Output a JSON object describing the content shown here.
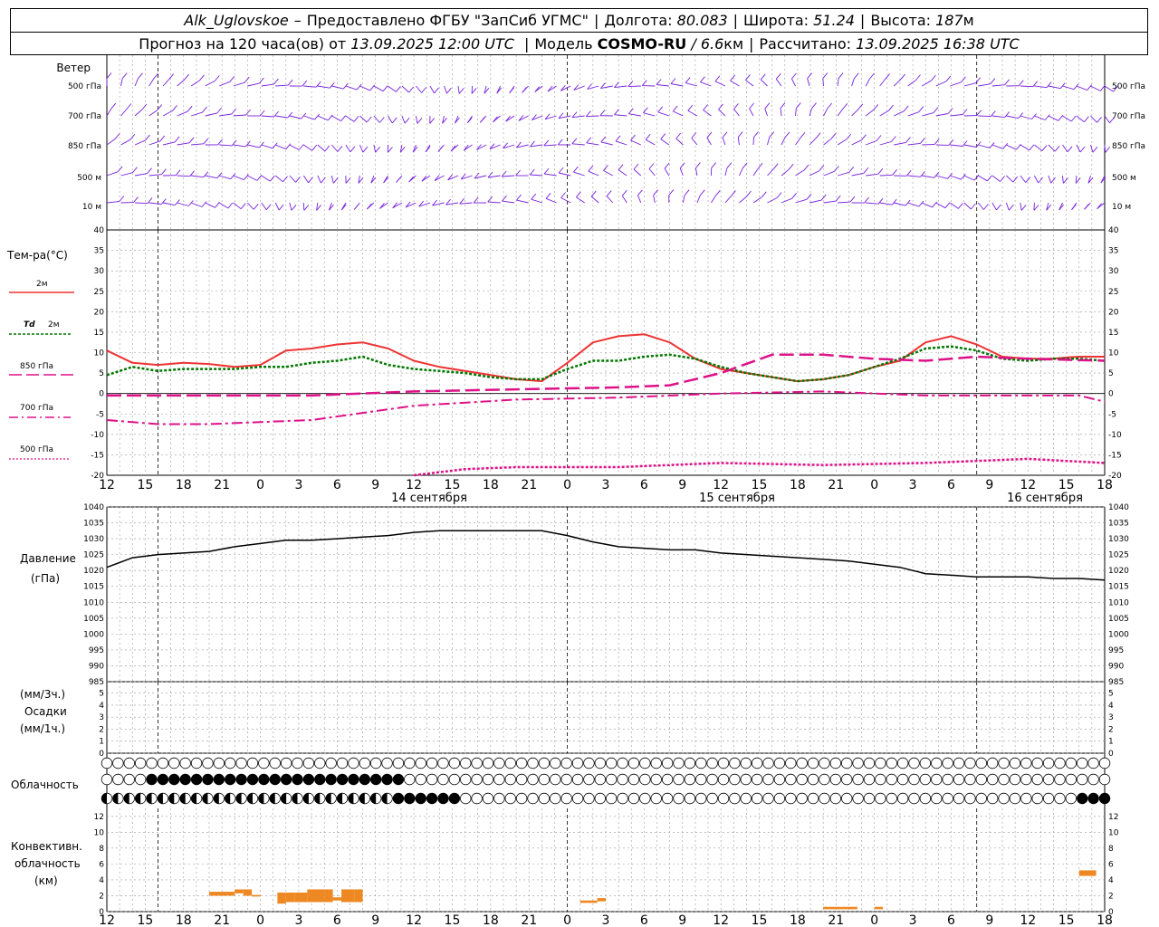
{
  "header": {
    "station": "Alk_Uglovskoe",
    "dash": "–",
    "provider": "Предоставлено ФГБУ \"ЗапСиб УГМС\"",
    "lon_label": "Долгота:",
    "lon_value": "80.083",
    "lat_label": "Широта:",
    "lat_value": "51.24",
    "alt_label": "Высота:",
    "alt_value": "187",
    "alt_unit": "м",
    "forecast_label": "Прогноз на 120 часа(ов) от",
    "forecast_time": "13.09.2025 12:00 UTC",
    "model_label": "Модель",
    "model_name": "COSMO-RU",
    "model_res": "/ 6.6",
    "model_res_unit": "км",
    "calc_label": "Рассчитано:",
    "calc_time": "13.09.2025 16:38 UTC"
  },
  "colors": {
    "t2m": "#ee3333",
    "td2m": "#007700",
    "t850": "#dd1188",
    "wind": "#7722dd",
    "cloud_conv": "#ee8822"
  },
  "labels": {
    "wind": "Ветер",
    "wind_levels": [
      "500 гПа",
      "700 гПа",
      "850 гПа",
      "500 м",
      "10  м"
    ],
    "temp_title": "Тем-ра(°С)",
    "temp_2m": "2м",
    "td": "Td",
    "td_2m": "2м",
    "t850": "850 гПа",
    "t700": "700 гПа",
    "t500": "500 гПа",
    "pressure": "Давление",
    "pressure_unit": "(гПа)",
    "precip_unit3": "(мм/3ч.)",
    "precip": "Осадки",
    "precip_unit1": "(мм/1ч.)",
    "clouds": "Облачность",
    "conv1": "Конвективн.",
    "conv2": "облачность",
    "conv3": "(км)"
  },
  "time_axis": {
    "hour_labels": [
      "12",
      "15",
      "18",
      "21",
      "0",
      "3",
      "6",
      "9",
      "12",
      "15",
      "18",
      "21",
      "0",
      "3",
      "6",
      "9",
      "12",
      "15",
      "18",
      "21",
      "0",
      "3",
      "6",
      "9",
      "12",
      "15",
      "18"
    ],
    "dates": [
      "14 сентября",
      "15 сентября",
      "16 сентября"
    ]
  },
  "chart_data": [
    {
      "type": "line",
      "title": "Тем-ра(°С)",
      "ylim": [
        -20,
        40
      ],
      "ticks": [
        "40",
        "35",
        "30",
        "25",
        "20",
        "15",
        "10",
        "5",
        "0",
        "-5",
        "-10",
        "-15",
        "-20"
      ],
      "x_hours": "hours since 13.09.2025 12:00 UTC",
      "series": [
        {
          "name": "2м",
          "x": [
            0,
            6,
            12,
            18,
            24,
            30,
            36,
            42,
            48,
            54,
            60,
            66,
            72,
            78,
            84,
            90,
            96,
            102,
            108,
            114,
            120,
            126,
            132,
            138,
            144,
            150,
            156,
            162,
            168,
            174,
            180,
            186,
            192,
            198,
            204,
            210,
            216,
            222,
            225,
            228,
            234
          ],
          "values": [
            10.5,
            7.5,
            7.0,
            7.5,
            7.2,
            6.5,
            7.0,
            10.5,
            11.0,
            12.0,
            12.5,
            11.0,
            8.0,
            6.5,
            5.5,
            4.5,
            3.5,
            3.0,
            7.5,
            12.5,
            14.0,
            14.5,
            12.5,
            8.5,
            6.0,
            5.0,
            4.0,
            3.0,
            3.5,
            4.5,
            6.5,
            8.0,
            12.5,
            14.0,
            12.0,
            9.0,
            8.5,
            8.5,
            8.8,
            9.0,
            9.0
          ]
        },
        {
          "name": "Td 2м",
          "x": [
            0,
            6,
            12,
            18,
            24,
            30,
            36,
            42,
            48,
            54,
            60,
            66,
            72,
            78,
            84,
            90,
            96,
            102,
            108,
            114,
            120,
            126,
            132,
            138,
            144,
            150,
            156,
            162,
            168,
            174,
            180,
            186,
            192,
            198,
            204,
            210,
            216,
            222,
            228,
            234
          ],
          "values": [
            4.5,
            6.5,
            5.5,
            6.0,
            6.0,
            6.0,
            6.5,
            6.5,
            7.5,
            8.0,
            9.0,
            7.0,
            6.0,
            5.5,
            5.0,
            4.0,
            3.5,
            3.5,
            6.0,
            8.0,
            8.0,
            9.0,
            9.5,
            8.5,
            6.5,
            5.0,
            4.0,
            3.0,
            3.5,
            4.5,
            6.5,
            8.5,
            11.0,
            11.5,
            10.5,
            8.5,
            8.0,
            8.5,
            8.5,
            8.0
          ]
        },
        {
          "name": "850 гПа",
          "x": [
            0,
            24,
            48,
            72,
            96,
            120,
            132,
            144,
            156,
            168,
            180,
            192,
            204,
            216,
            234
          ],
          "values": [
            -0.5,
            -0.5,
            -0.5,
            0.5,
            1.0,
            1.5,
            2.0,
            5.0,
            9.5,
            9.5,
            8.5,
            8.0,
            9.0,
            8.5,
            8.0
          ]
        },
        {
          "name": "700 гПа",
          "x": [
            0,
            6,
            12,
            24,
            48,
            72,
            96,
            120,
            144,
            168,
            192,
            216,
            228,
            234
          ],
          "values": [
            -6.5,
            -7.0,
            -7.5,
            -7.5,
            -6.5,
            -3.0,
            -1.5,
            -1.0,
            0.0,
            0.5,
            -0.5,
            -0.5,
            -0.5,
            -2.0
          ]
        },
        {
          "name": "500 гПа",
          "x": [
            72,
            84,
            96,
            120,
            144,
            168,
            192,
            216,
            234
          ],
          "values": [
            -20.0,
            -18.5,
            -18.0,
            -18.0,
            -17.0,
            -17.5,
            -17.0,
            -16.0,
            -17.0
          ]
        }
      ]
    },
    {
      "type": "line",
      "title": "Давление",
      "ylabel": "(гПа)",
      "ylim": [
        985,
        1040
      ],
      "ticks": [
        "1040",
        "1035",
        "1030",
        "1025",
        "1020",
        "1015",
        "1010",
        "1005",
        "1000",
        "995",
        "990",
        "985"
      ],
      "series": [
        {
          "name": "Давление",
          "x": [
            0,
            6,
            12,
            18,
            24,
            30,
            36,
            42,
            48,
            54,
            60,
            66,
            72,
            78,
            84,
            90,
            96,
            102,
            108,
            114,
            120,
            126,
            132,
            138,
            144,
            150,
            156,
            162,
            168,
            174,
            180,
            186,
            192,
            198,
            204,
            210,
            216,
            222,
            228,
            234
          ],
          "values": [
            1021,
            1024,
            1025,
            1025.5,
            1026,
            1027.5,
            1028.5,
            1029.5,
            1029.5,
            1030,
            1030.5,
            1031,
            1032,
            1032.5,
            1032.5,
            1032.5,
            1032.5,
            1032.5,
            1031,
            1029,
            1027.5,
            1027,
            1026.5,
            1026.5,
            1025.5,
            1025,
            1024.5,
            1024,
            1023.5,
            1023,
            1022,
            1021,
            1019,
            1018.5,
            1018,
            1018,
            1018,
            1017.5,
            1017.5,
            1017
          ]
        }
      ]
    },
    {
      "type": "bar",
      "title": "Осадки",
      "ylabel": "(мм/3ч.) (мм/1ч.)",
      "ylim": [
        0,
        5
      ],
      "ticks": [
        "5",
        "4",
        "3",
        "2",
        "1",
        "0"
      ],
      "values": []
    },
    {
      "type": "bar",
      "title": "Конвективн. облачность",
      "ylabel": "(км)",
      "ylim": [
        0,
        13
      ],
      "ticks": [
        "12",
        "10",
        "8",
        "6",
        "4",
        "2",
        "0"
      ],
      "bars": [
        {
          "x0": 24,
          "x1": 30,
          "bottom": 2.0,
          "top": 2.5
        },
        {
          "x0": 30,
          "x1": 32,
          "bottom": 2.3,
          "top": 2.8
        },
        {
          "x0": 32,
          "x1": 34,
          "bottom": 2.0,
          "top": 2.8
        },
        {
          "x0": 34,
          "x1": 36,
          "bottom": 1.9,
          "top": 2.1
        },
        {
          "x0": 40,
          "x1": 42,
          "bottom": 1.0,
          "top": 2.4
        },
        {
          "x0": 42,
          "x1": 44,
          "bottom": 1.2,
          "top": 2.4
        },
        {
          "x0": 44,
          "x1": 47,
          "bottom": 1.2,
          "top": 2.4
        },
        {
          "x0": 47,
          "x1": 51,
          "bottom": 1.2,
          "top": 2.8
        },
        {
          "x0": 51,
          "x1": 53,
          "bottom": 1.2,
          "top": 2.8
        },
        {
          "x0": 53,
          "x1": 55,
          "bottom": 1.4,
          "top": 1.8
        },
        {
          "x0": 55,
          "x1": 58,
          "bottom": 1.2,
          "top": 2.8
        },
        {
          "x0": 58,
          "x1": 60,
          "bottom": 1.2,
          "top": 2.8
        },
        {
          "x0": 111,
          "x1": 115,
          "bottom": 1.1,
          "top": 1.4
        },
        {
          "x0": 115,
          "x1": 117,
          "bottom": 1.3,
          "top": 1.7
        },
        {
          "x0": 168,
          "x1": 176,
          "bottom": 0.3,
          "top": 0.6
        },
        {
          "x0": 180,
          "x1": 182,
          "bottom": 0.3,
          "top": 0.6
        },
        {
          "x0": 228,
          "x1": 232,
          "bottom": 4.5,
          "top": 5.2
        }
      ]
    }
  ],
  "cloud_rows": {
    "upper": "0000000000000000000000000000000000000000000000000000000000000000000000000000000000000000000000000000000000000000000000003344544500000000000044444",
    "middle": "0000444444444444444444444440000000000000000000000000000000000000000000000000000000000000000000000000000044000000000000000000000004444",
    "lower": "3333333333333333333333333344444400000000000000000000000000000000000000000000000000000004444444444444000000000000000000000000000000000"
  }
}
